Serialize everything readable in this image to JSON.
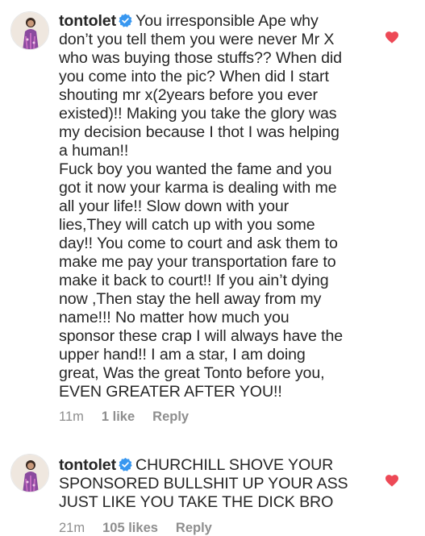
{
  "comments": [
    {
      "username": "tontolet",
      "first_line": "You irresponsible Ape why\ndon’t you tell them you were never Mr X\nwho was buying those stuffs?? When did\nyou come into the pic? When did I start\nshouting mr x(2years before you ever\nexisted)!! Making you take the glory was\nmy decision because I thot I was helping\na human!!",
      "second_para": "Fuck boy you wanted the fame and you\ngot it now your karma is dealing with me\nall your life!! Slow down with your\nlies,They will catch up with you some\nday!! You come to court and ask them to\nmake me pay your transportation fare to\nmake it back to court!! If you ain’t dying\nnow ,Then stay the hell away from my\nname!!! No matter how much you\nsponsor these crap I will always have the\nupper hand!! I am a star, I am doing\ngreat, Was the great Tonto before you,\nEVEN GREATER AFTER YOU!!",
      "time": "11m",
      "likes": "1 like",
      "reply": "Reply",
      "heart_color": "#ed4956"
    },
    {
      "username": "tontolet",
      "text": "CHURCHILL SHOVE YOUR\nSPONSORED BULLSHIT UP YOUR ASS\nJUST LIKE YOU TAKE THE DICK BRO",
      "time": "21m",
      "likes": "105 likes",
      "reply": "Reply",
      "heart_color": "#ed4956"
    }
  ],
  "icons": {
    "verified": "verified-badge-icon",
    "heart": "heart-icon"
  },
  "colors": {
    "verified": "#3897f0",
    "meta": "#8e8e8e",
    "text": "#262626"
  }
}
